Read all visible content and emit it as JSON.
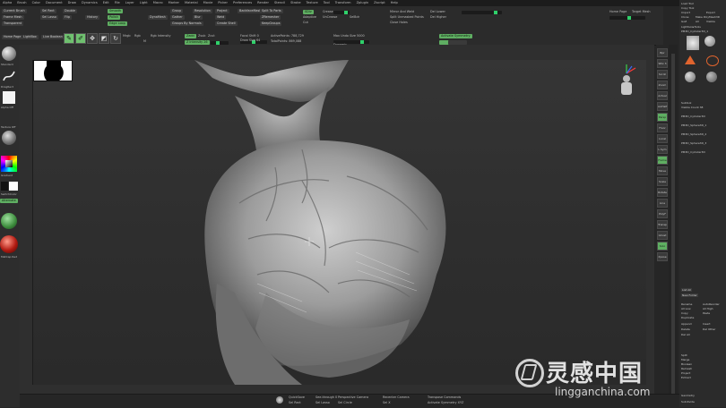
{
  "menu": [
    "Alpha",
    "Brush",
    "Color",
    "Document",
    "Draw",
    "Dynamics",
    "Edit",
    "File",
    "Layer",
    "Light",
    "Macro",
    "Marker",
    "Material",
    "Movie",
    "Picker",
    "Preferences",
    "Render",
    "Stencil",
    "Stroke",
    "Texture",
    "Tool",
    "Transform",
    "Zplugin",
    "Zscript",
    "Help"
  ],
  "top_right": {
    "quicksave": "QuickSave",
    "see_through": "See-through 0",
    "menus": "Menus",
    "default_script": "DefaultZScript"
  },
  "shelf": {
    "home_page": "Home Page",
    "lightbox": "LightBox",
    "live_boolean": "Live Boolean",
    "edit": "Edit",
    "draw": "Draw",
    "move": "Move",
    "scale": "Scale",
    "rotate": "Rotate",
    "mrgb": "Mrgb",
    "rgb": "Rgb",
    "m": "M",
    "zadd": "Zadd",
    "zsub": "Zsub",
    "zcut": "Zcut",
    "rgb_intensity": "Rgb Intensity",
    "z_intensity": "Z Intensity 26",
    "focal_shift": "Focal Shift 0",
    "draw_size": "Draw Size 64",
    "dynamic": "Dynamic",
    "active_points": "ActivePoints: 788,729",
    "total_points": "TotalPoints: 869,088",
    "max_undo": "Max Undo Size 5000",
    "dynamic_label": "Dynamic",
    "activate_symmetry": "Activate Symmetry",
    "frame_mesh": "Frame Mesh",
    "current_brush": "Current Brush",
    "transp": "Transparent",
    "sel_rect": "Sel Rect",
    "sel_lasso": "Sel Lasso",
    "selected": "Selected",
    "double": "Double",
    "flip": "Flip",
    "history": "History",
    "groups_by_normals": "Groups By Normals",
    "gather": "Gather",
    "resolution": "Resolution",
    "polish": "Polish",
    "backface": "BackfaceMask",
    "weld": "Weld",
    "groups_split": "Groups Split",
    "dynamesh": "DynaMesh",
    "group": "Group",
    "project": "Project",
    "blur": "Blur",
    "create_shell": "Create Shell",
    "split_to_parts": "Split To Parts",
    "delete_hidden": "Delete Hidden",
    "zremesher": "ZRemesher",
    "keep_groups": "KeepGroups",
    "smooth": "Smooth",
    "edge_loop": "Edge Loop",
    "panel_loops": "Panel Loops",
    "subdiv": "SDiv",
    "mirror_weld": "Mirror And Weld",
    "split_unmasked": "Split Unmasked Points",
    "adaptive": "Adaptive",
    "cut": "Cut",
    "close_holes": "Close Holes",
    "crease": "Crease",
    "uncrease": "UnCrease",
    "sel_bdr": "SelBdr",
    "del_lower": "Del Lower",
    "del_higher": "Del Higher",
    "home_page_r": "Home Page",
    "target_mesh": "Target Mesh"
  },
  "left": {
    "brush_label": "Standard",
    "stroke_label": "DragRect",
    "alpha_label": "Alpha Off",
    "texture_label": "Texture Off",
    "material_label": "MatCap Red",
    "gradient": "Gradient",
    "switch_color": "SwitchColor",
    "alternate": "Alternate"
  },
  "right_tools": [
    "Bpr",
    "SPix 3",
    "Scroll",
    "Zoom",
    "Actual",
    "AAHalf",
    "Persp",
    "Floor",
    "Local",
    "L.Sym",
    "Frame",
    "Move",
    "Scale",
    "Rotate",
    "Line Fill",
    "PolyF",
    "Transp",
    "Ghost",
    "Solo",
    "Xpose"
  ],
  "right_panel": {
    "load_tool": "Load Tool",
    "save_as": "Save As",
    "copy_tool": "Copy Tool",
    "paste_tool": "Paste Tool",
    "import": "Import",
    "export": "Export",
    "clone": "Clone",
    "make_polymesh": "Make PolyMesh3D",
    "goz": "GoZ",
    "all": "All",
    "visible": "Visible",
    "r": "R",
    "lightbox_tools": "Lightbox▸Tools",
    "tool_name": "PM3D_Cylinder3D_1",
    "subtool": "Subtool",
    "visible_count": "Visible Count 38",
    "items": [
      "PM3D_Cylinder3D",
      "PM3D_Sphere3D_1",
      "PM3D_Sphere3D_2",
      "PM3D_Sphere3D_3",
      "PM3D_Cylinder3D"
    ],
    "list_all": "List All",
    "new_folder": "New Folder",
    "rename": "Rename",
    "auto_reorder": "AutoReorder",
    "all_low": "All Low",
    "all_high": "All High",
    "copy": "Copy",
    "paste": "Paste",
    "duplicate": "Duplicate",
    "append": "Append",
    "insert": "Insert",
    "delete": "Delete",
    "del_other": "Del Other",
    "del_all": "Del All",
    "split": "Split",
    "merge": "Merge",
    "boolean": "Boolean",
    "remesh": "Remesh",
    "project": "Project",
    "extract": "Extract",
    "geometry": "Geometry",
    "subdivide": "Subdivide"
  },
  "bottom": {
    "quicksave": "QuickSave",
    "see_through": "See-through 0",
    "perspective": "Perspective Camera",
    "recenter": "Recenter Camera",
    "sel_rect": "Sel Rect",
    "mirror": "Mirror",
    "sel_lasso": "Sel Lasso",
    "sel_circle": "Sel Circle",
    "sel_x": "Sel X",
    "transp_comm": "Transpose Commands",
    "pose": "Pose",
    "dynamic_label": "Dynamic",
    "symmetry": "Symmetry",
    "activate_symmetry": "Activate Symmetry XYZ"
  },
  "watermark": {
    "cn": "灵感中国",
    "url": "lingganchina.com"
  },
  "colors": {
    "accent": "#5fae62",
    "bg": "#262626",
    "panel": "#2b2b2b"
  }
}
